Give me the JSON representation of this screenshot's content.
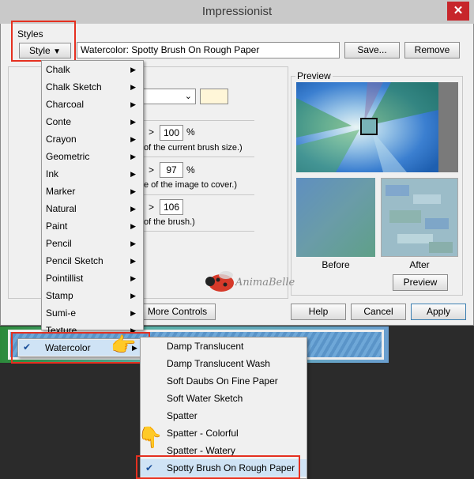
{
  "dialog": {
    "title": "Impressionist",
    "close_glyph": "✕",
    "styles_label": "Styles",
    "style_button_label": "Style",
    "style_name": "Watercolor: Spotty Brush On Rough Paper",
    "save_label": "Save...",
    "remove_label": "Remove",
    "preview_title": "Preview",
    "before_label": "Before",
    "after_label": "After",
    "preview_button": "Preview",
    "more_controls": "More Controls",
    "help": "Help",
    "cancel": "Cancel",
    "apply": "Apply"
  },
  "params": {
    "value1": "100",
    "unit1": "%",
    "hint1": "of the current brush size.)",
    "value2": "97",
    "unit2": "%",
    "hint2": "e of the image to cover.)",
    "value3": "106",
    "hint3": "of the brush.)",
    "arrow": ">"
  },
  "style_menu": {
    "items": [
      "Chalk",
      "Chalk Sketch",
      "Charcoal",
      "Conte",
      "Crayon",
      "Geometric",
      "Ink",
      "Marker",
      "Natural",
      "Paint",
      "Pencil",
      "Pencil Sketch",
      "Pointillist",
      "Stamp",
      "Sumi-e",
      "Texture",
      "Watercolor"
    ],
    "selected": "Watercolor",
    "check": "✔",
    "submenu_arrow": "▶"
  },
  "watercolor_submenu": {
    "items": [
      "Damp Translucent",
      "Damp Translucent Wash",
      "Soft Daubs On Fine Paper",
      "Soft Water Sketch",
      "Spatter",
      "Spatter - Colorful",
      "Spatter - Watery",
      "Spotty Brush On Rough Paper"
    ],
    "selected": "Spotty Brush On Rough Paper",
    "check": "✔"
  },
  "watermark": {
    "text": "AnimaBelle"
  },
  "colors": {
    "highlight_red": "#e53020",
    "swatch": "#fff6d8",
    "selection": "#cfe3f5"
  }
}
